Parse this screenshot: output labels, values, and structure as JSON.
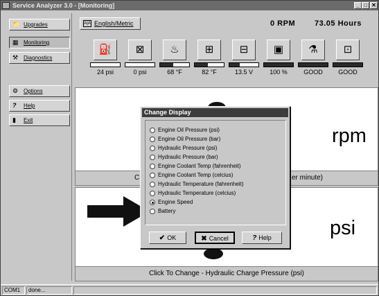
{
  "window": {
    "title": "Service Analyzer 3.0 - [Monitoring]",
    "controls": {
      "minimize": "_",
      "restore": "□",
      "close": "✕"
    }
  },
  "sidebar": {
    "items": [
      {
        "label": "Upgrades",
        "icon": "upgrades-icon",
        "glyph": "📁"
      },
      {
        "label": "Monitoring",
        "icon": "monitoring-icon",
        "glyph": "▦"
      },
      {
        "label": "Diagnostics",
        "icon": "diagnostics-icon",
        "glyph": "⚒"
      },
      {
        "label": "Options",
        "icon": "options-icon",
        "glyph": "⚙"
      },
      {
        "label": "Help",
        "icon": "help-icon",
        "glyph": "?"
      },
      {
        "label": "Exit",
        "icon": "exit-icon",
        "glyph": "▮"
      }
    ]
  },
  "toolbar": {
    "units_button": "English/Metric",
    "units_icon": "A|A"
  },
  "status": {
    "rpm": "0 RPM",
    "hours": "73.05 Hours"
  },
  "gauges": [
    {
      "icon": "oil-can-icon",
      "glyph": "⛽",
      "value": "24 psi",
      "level": 0.0
    },
    {
      "icon": "hydraulic-pressure-icon",
      "glyph": "⊠",
      "value": "0 psi",
      "level": 0.0
    },
    {
      "icon": "coolant-temp-icon",
      "glyph": "♨",
      "value": "68 °F",
      "level": 0.45
    },
    {
      "icon": "hydraulic-temp-icon",
      "glyph": "⊞",
      "value": "82 °F",
      "level": 0.45
    },
    {
      "icon": "battery-icon",
      "glyph": "⊟",
      "value": "13.5 V",
      "level": 0.35
    },
    {
      "icon": "fuel-icon",
      "glyph": "▣",
      "value": "100 %",
      "level": 1.0
    },
    {
      "icon": "filter-icon",
      "glyph": "⚗",
      "value": "GOOD",
      "level": 1.0
    },
    {
      "icon": "hydraulic-filter-icon",
      "glyph": "⊡",
      "value": "GOOD",
      "level": 1.0
    }
  ],
  "panels": {
    "upper": {
      "unit": "rpm",
      "click_left": "Cli",
      "click_right": "er minute)"
    },
    "lower": {
      "unit": "psi",
      "click_text": "Click To Change - Hydraulic Charge Pressure (psi)"
    }
  },
  "dialog": {
    "title": "Change Display",
    "options": [
      {
        "label": "Engine Oil Pressure (psi)",
        "selected": false
      },
      {
        "label": "Engine Oil Pressure (bar)",
        "selected": false
      },
      {
        "label": "Hydraulic Pressure  (psi)",
        "selected": false
      },
      {
        "label": "Hydraulic Pressure  (bar)",
        "selected": false
      },
      {
        "label": "Engine Coolant Temp (fahrenheit)",
        "selected": false
      },
      {
        "label": "Engine Coolant Temp (celcius)",
        "selected": false
      },
      {
        "label": "Hydraulic Temperature (fahrenheit)",
        "selected": false
      },
      {
        "label": "Hydraulic Temperature (celcius)",
        "selected": false
      },
      {
        "label": "Engine Speed",
        "selected": true
      },
      {
        "label": "Battery",
        "selected": false
      }
    ],
    "buttons": {
      "ok": "OK",
      "cancel": "Cancel",
      "help": "Help"
    }
  },
  "statusbar": {
    "port": "COM1",
    "message": "done..."
  }
}
